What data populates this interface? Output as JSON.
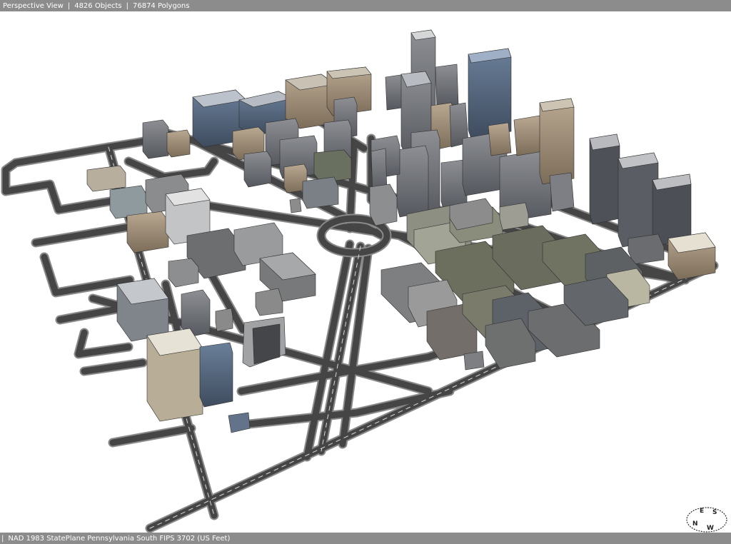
{
  "status_top": {
    "view_mode": "Perspective View",
    "objects": "4826 Objects",
    "polygons": "76874 Polygons"
  },
  "status_bottom": {
    "coordinate_system": "NAD 1983 StatePlane Pennsylvania South FIPS 3702 (US Feet)"
  },
  "compass": {
    "n": "N",
    "e": "E",
    "s": "S",
    "w": "W"
  },
  "colors": {
    "status_bar": "#8c8c8c",
    "road": "#454545",
    "road_edge": "#8a8a8a",
    "background": "#ffffff"
  }
}
